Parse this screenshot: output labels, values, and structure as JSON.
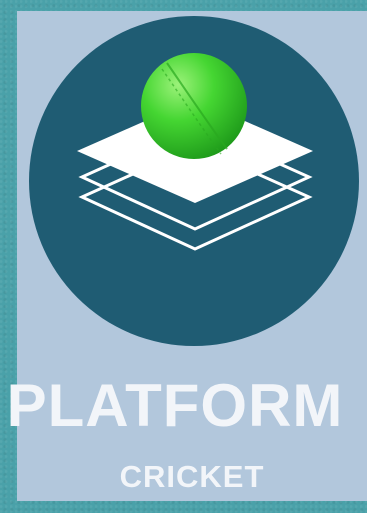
{
  "brand": {
    "title": "PLATFORM",
    "subtitle": "CRICKET"
  },
  "icons": {
    "logo": "cricket-ball-on-layered-platform-icon"
  },
  "colors": {
    "background_border": "#4aa1a9",
    "panel": "#b2c7dc",
    "circle": "#1f5c73",
    "ball": "#3fcf2f",
    "layers": "#ffffff",
    "text": "#f2f5f9"
  }
}
